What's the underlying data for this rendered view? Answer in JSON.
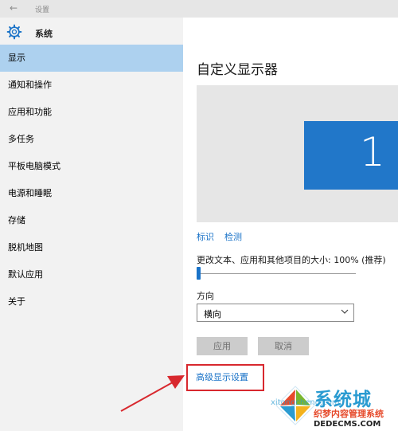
{
  "titlebar": {
    "back_icon": "←",
    "title": "设置"
  },
  "sidebar": {
    "header": "系统",
    "items": [
      {
        "label": "显示"
      },
      {
        "label": "通知和操作"
      },
      {
        "label": "应用和功能"
      },
      {
        "label": "多任务"
      },
      {
        "label": "平板电脑模式"
      },
      {
        "label": "电源和睡眠"
      },
      {
        "label": "存储"
      },
      {
        "label": "脱机地图"
      },
      {
        "label": "默认应用"
      },
      {
        "label": "关于"
      }
    ]
  },
  "main": {
    "title": "自定义显示器",
    "monitor_number": "1",
    "identify_link": "标识",
    "detect_link": "检测",
    "scale_label": "更改文本、应用和其他项目的大小: 100% (推荐)",
    "scale_fraction": 0.0,
    "orientation_label": "方向",
    "orientation_value": "横向",
    "apply_button": "应用",
    "cancel_button": "取消",
    "advanced_link": "高级显示设置"
  },
  "watermark": {
    "brand": "系统城",
    "url_top": "xitongcheng.com",
    "caption": "织梦内容管理系统",
    "url_bottom": "DEDECMS.COM"
  },
  "colors": {
    "accent": "#1a73c8",
    "selected_bg": "#add1ef",
    "monitor": "#2177c9",
    "highlight": "#d8282e"
  }
}
